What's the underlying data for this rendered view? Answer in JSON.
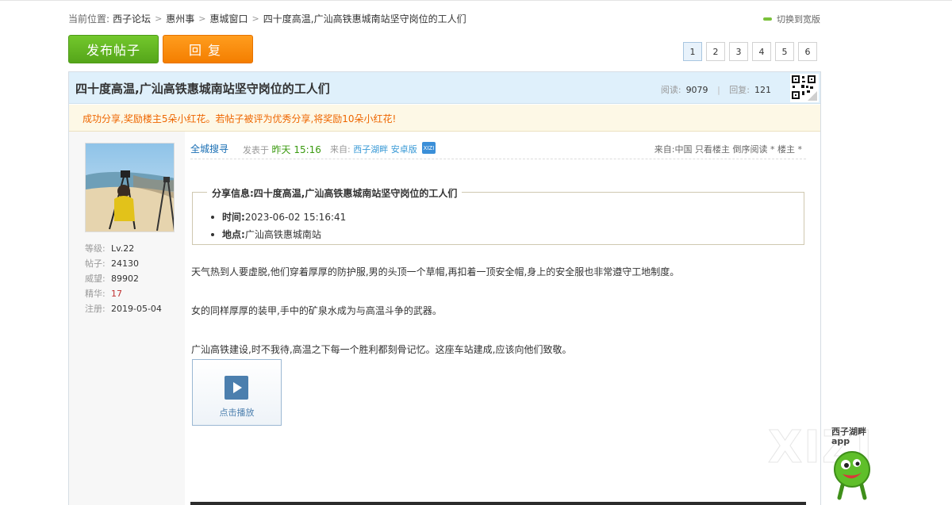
{
  "breadcrumb": {
    "label": "当前位置:",
    "items": [
      "西子论坛",
      "惠州事",
      "惠城窗口",
      "四十度高温,广汕高铁惠城南站坚守岗位的工人们"
    ]
  },
  "switch_wide": "切换到宽版",
  "buttons": {
    "post": "发布帖子",
    "reply": "回复"
  },
  "pager": {
    "pages": [
      "1",
      "2",
      "3",
      "4",
      "5",
      "6"
    ],
    "current": "1"
  },
  "thread": {
    "title": "四十度高温,广汕高铁惠城南站坚守岗位的工人们",
    "views_label": "阅读:",
    "views": "9079",
    "replies_label": "回复:",
    "replies": "121"
  },
  "notice": "成功分享,奖励楼主5朵小红花。若帖子被评为优秀分享,将奖励10朵小红花!",
  "author": {
    "level_label": "等级:",
    "level": "Lv.22",
    "posts_label": "帖子:",
    "posts": "24130",
    "prestige_label": "威望:",
    "prestige": "89902",
    "elite_label": "精华:",
    "elite": "17",
    "reg_label": "注册:",
    "reg": "2019-05-04"
  },
  "post": {
    "author_name": "全城搜寻",
    "pub_label": "发表于",
    "pub_time": "昨天 15:16",
    "from_label": "来自:",
    "from_source": "西子湖畔 安卓版",
    "badge": "XIZI",
    "right_links": "来自:中国 只看楼主 倒序阅读 * 楼主 *"
  },
  "share": {
    "legend": "分享信息:四十度高温,广汕高铁惠城南站坚守岗位的工人们",
    "time_label": "时间:",
    "time": "2023-06-02 15:16:41",
    "place_label": "地点:",
    "place": "广汕高铁惠城南站"
  },
  "paragraphs": [
    "天气热到人要虚脱,他们穿着厚厚的防护服,男的头顶一个草帽,再扣着一顶安全帽,身上的安全服也非常遵守工地制度。",
    "女的同样厚厚的装甲,手中的矿泉水成为与高温斗争的武器。",
    "广汕高铁建设,时不我待,高温之下每一个胜利都刻骨记忆。这座车站建成,应该向他们致敬。"
  ],
  "video_label": "点击播放",
  "app_float": {
    "line1": "西子湖畔",
    "line2": "app"
  },
  "watermark": "XIZI",
  "colors": {
    "green_btn": "#5cb21f",
    "orange_btn": "#f7870b",
    "title_bg": "#dff0fb",
    "notice_text": "#ee6600"
  }
}
